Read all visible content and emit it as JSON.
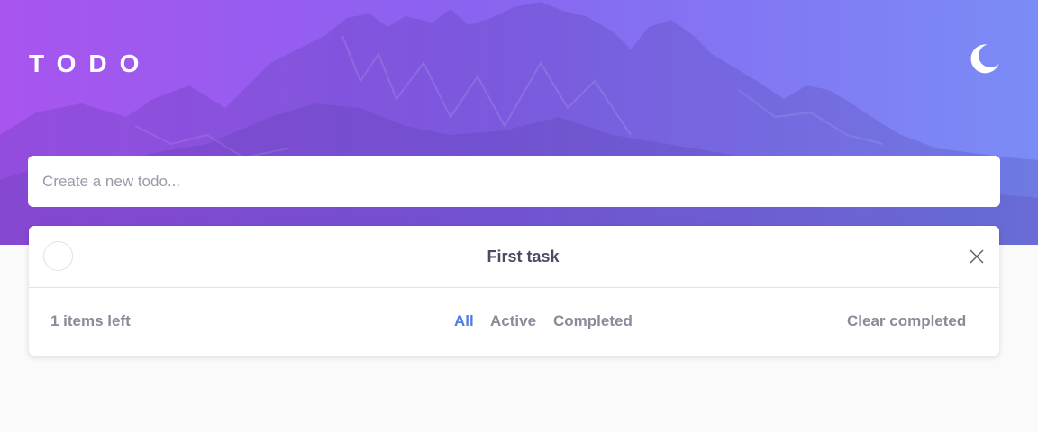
{
  "header": {
    "title": "TODO",
    "theme_icon": "moon-icon",
    "gradient_colors": [
      "#a855ef",
      "#8a63f0",
      "#7a8cf6"
    ]
  },
  "new_todo": {
    "placeholder": "Create a new todo...",
    "value": ""
  },
  "todos": [
    {
      "text": "First task",
      "completed": false
    }
  ],
  "footer": {
    "items_left": "1 items left",
    "filters": [
      {
        "label": "All",
        "active": true
      },
      {
        "label": "Active",
        "active": false
      },
      {
        "label": "Completed",
        "active": false
      }
    ],
    "clear_label": "Clear completed"
  },
  "colors": {
    "accent": "#4f7fe0",
    "text": "#4a4b63",
    "muted": "#8a8a9a"
  }
}
